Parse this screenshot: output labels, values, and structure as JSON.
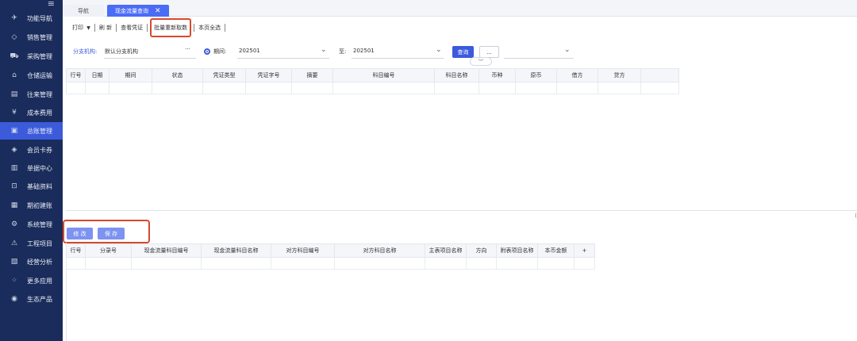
{
  "sidebar": {
    "collapse_icon": "collapse-menu-icon",
    "items": [
      {
        "icon": "send-icon",
        "glyph": "✈",
        "label": "功能导航"
      },
      {
        "icon": "tag-icon",
        "glyph": "◇",
        "label": "销售管理"
      },
      {
        "icon": "cart-icon",
        "glyph": "⛟",
        "label": "采购管理"
      },
      {
        "icon": "warehouse-icon",
        "glyph": "⌂",
        "label": "仓储运输"
      },
      {
        "icon": "receipt-icon",
        "glyph": "▤",
        "label": "往来管理"
      },
      {
        "icon": "cost-icon",
        "glyph": "¥",
        "label": "成本费用"
      },
      {
        "icon": "ledger-icon",
        "glyph": "▣",
        "label": "总账管理"
      },
      {
        "icon": "diamond-icon",
        "glyph": "◈",
        "label": "会员卡券"
      },
      {
        "icon": "document-icon",
        "glyph": "▥",
        "label": "单据中心"
      },
      {
        "icon": "data-icon",
        "glyph": "⊡",
        "label": "基础资料"
      },
      {
        "icon": "calendar-icon",
        "glyph": "▦",
        "label": "期初建账"
      },
      {
        "icon": "gear-icon",
        "glyph": "⚙",
        "label": "系统管理"
      },
      {
        "icon": "warning-icon",
        "glyph": "⚠",
        "label": "工程项目"
      },
      {
        "icon": "chart-icon",
        "glyph": "▧",
        "label": "经营分析"
      },
      {
        "icon": "apps-icon",
        "glyph": "⁘",
        "label": "更多应用"
      },
      {
        "icon": "ecosystem-icon",
        "glyph": "◉",
        "label": "生态产品"
      }
    ],
    "active_index": 6
  },
  "tabs": {
    "nav_label": "导航",
    "current_label": "现金流量查询",
    "close_glyph": "✕"
  },
  "toolbar": {
    "print_label": "打印",
    "print_arrow": "▼",
    "refresh_label": "刷 新",
    "view_voucher_label": "查看凭证",
    "batch_recalc_label": "批量重新取数",
    "select_all_label": "本页全选"
  },
  "filters": {
    "branch_label": "分支机构:",
    "branch_value": "默认分支机构",
    "branch_more": "···",
    "period_label": "期间:",
    "period_from": "202501",
    "to_label": "至:",
    "period_to": "202501",
    "query_label": "查询",
    "more_label": "...",
    "expand_glyph": "︾",
    "extra_select_value": ""
  },
  "top_table": {
    "columns": [
      "行号",
      "日期",
      "期间",
      "状态",
      "凭证类型",
      "凭证字号",
      "摘要",
      "科目编号",
      "科目名称",
      "币种",
      "原币",
      "借方",
      "贷方"
    ]
  },
  "scroll_indicator": "(",
  "actions": {
    "edit_label": "修 改",
    "save_label": "保 存"
  },
  "bottom_table": {
    "columns": [
      "行号",
      "分录号",
      "现金流量科目编号",
      "现金流量科目名称",
      "对方科目编号",
      "对方科目名称",
      "主表项目名称",
      "方向",
      "附表项目名称",
      "本币金额",
      "+"
    ]
  },
  "colors": {
    "sidebar_bg": "#1a2c5b",
    "accent": "#3b5bdb",
    "highlight_border": "#d9482b"
  }
}
